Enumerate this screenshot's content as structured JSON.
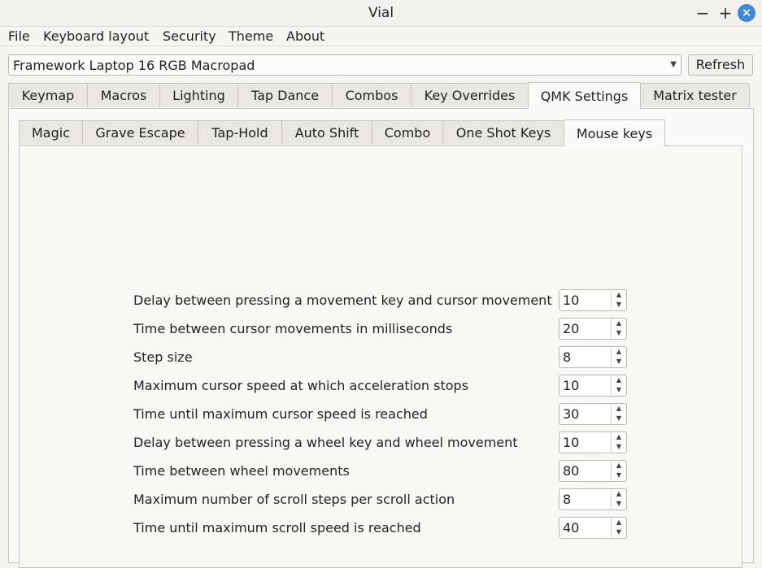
{
  "window": {
    "title": "Vial",
    "minimize": "−",
    "maximize": "+",
    "close": "✕"
  },
  "menu": [
    "File",
    "Keyboard layout",
    "Security",
    "Theme",
    "About"
  ],
  "device": {
    "selected": "Framework Laptop 16 RGB Macropad",
    "arrow": "▼"
  },
  "refresh_label": "Refresh",
  "main_tabs": [
    "Keymap",
    "Macros",
    "Lighting",
    "Tap Dance",
    "Combos",
    "Key Overrides",
    "QMK Settings",
    "Matrix tester"
  ],
  "main_tab_active": "QMK Settings",
  "sub_tabs": [
    "Magic",
    "Grave Escape",
    "Tap-Hold",
    "Auto Shift",
    "Combo",
    "One Shot Keys",
    "Mouse keys"
  ],
  "sub_tab_active": "Mouse keys",
  "settings": [
    {
      "label": "Delay between pressing a movement key and cursor movement",
      "value": "10"
    },
    {
      "label": "Time between cursor movements in milliseconds",
      "value": "20"
    },
    {
      "label": "Step size",
      "value": "8"
    },
    {
      "label": "Maximum cursor speed at which acceleration stops",
      "value": "10"
    },
    {
      "label": "Time until maximum cursor speed is reached",
      "value": "30"
    },
    {
      "label": "Delay between pressing a wheel key and wheel movement",
      "value": "10"
    },
    {
      "label": "Time between wheel movements",
      "value": "80"
    },
    {
      "label": "Maximum number of scroll steps per scroll action",
      "value": "8"
    },
    {
      "label": "Time until maximum scroll speed is reached",
      "value": "40"
    }
  ],
  "spin_up": "▲",
  "spin_down": "▼",
  "colors": {
    "close_button": "#3f8ad8",
    "background": "#f7f5f2"
  }
}
